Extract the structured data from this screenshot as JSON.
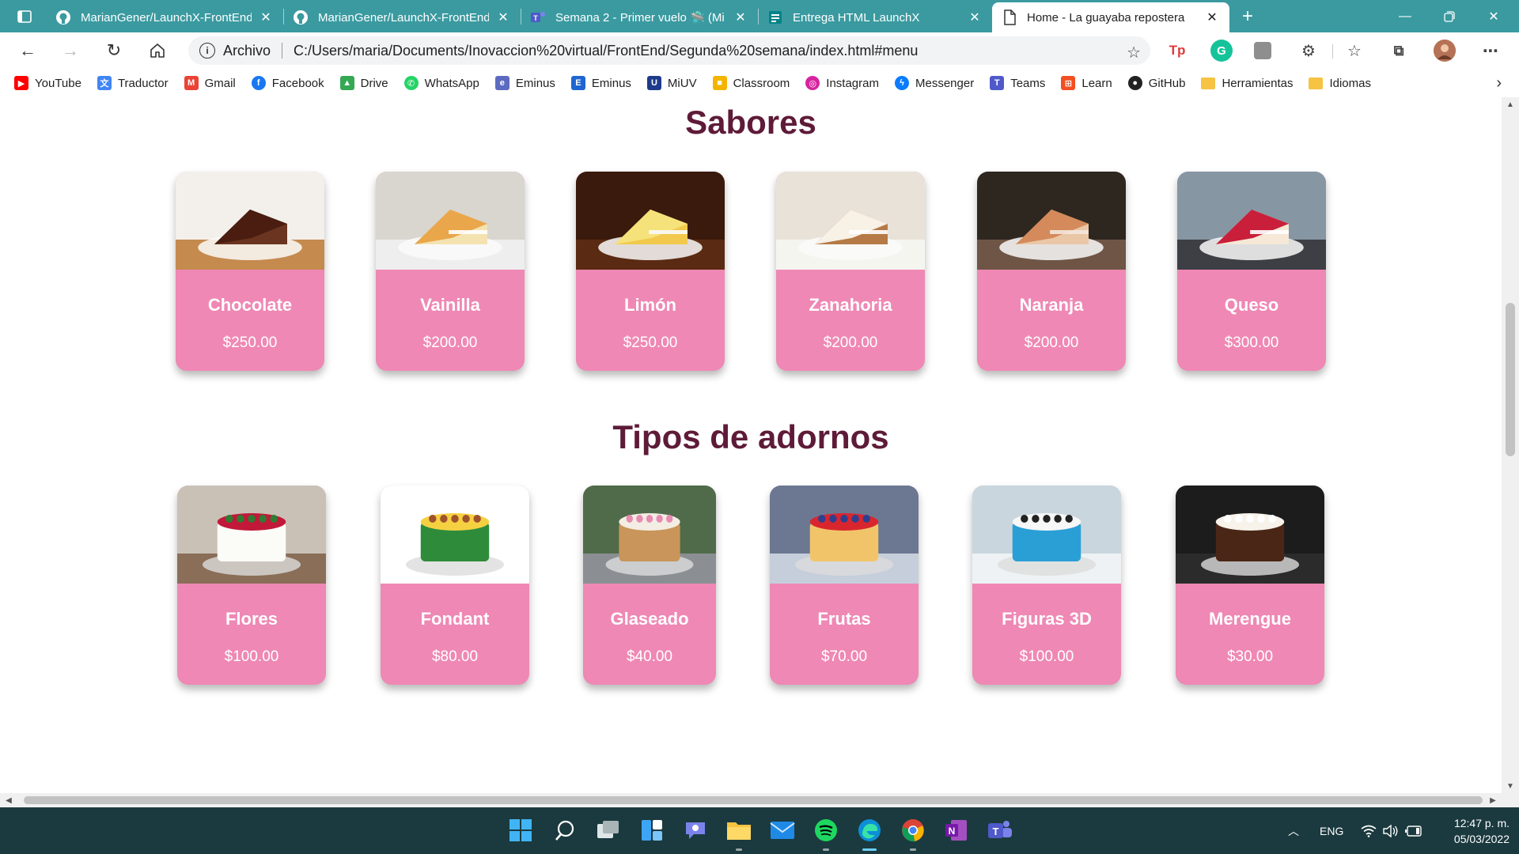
{
  "browser": {
    "tabs": [
      {
        "title": "MarianGener/LaunchX-FrontEnd",
        "icon": "github-icon",
        "active": false
      },
      {
        "title": "MarianGener/LaunchX-FrontEnd",
        "icon": "github-icon",
        "active": false
      },
      {
        "title": "Semana 2 - Primer vuelo 🛸 (Mi",
        "icon": "teams-icon",
        "active": false
      },
      {
        "title": "Entrega HTML LaunchX",
        "icon": "forms-icon",
        "active": false
      },
      {
        "title": "Home - La guayaba repostera",
        "icon": "page-icon",
        "active": true
      }
    ],
    "address": {
      "label": "Archivo",
      "url": "C:/Users/maria/Documents/Inovaccion%20virtual/FrontEnd/Segunda%20semana/index.html#menu"
    },
    "bookmarks": [
      {
        "label": "YouTube",
        "icon": "youtube-icon",
        "color": "#ff0000"
      },
      {
        "label": "Traductor",
        "icon": "translate-icon",
        "color": "#4285f4"
      },
      {
        "label": "Gmail",
        "icon": "gmail-icon",
        "color": "#ea4335"
      },
      {
        "label": "Facebook",
        "icon": "facebook-icon",
        "color": "#1877f2"
      },
      {
        "label": "Drive",
        "icon": "drive-icon",
        "color": "#34a853"
      },
      {
        "label": "WhatsApp",
        "icon": "whatsapp-icon",
        "color": "#25d366"
      },
      {
        "label": "Eminus",
        "icon": "eminus-icon",
        "color": "#5c6bc0"
      },
      {
        "label": "Eminus",
        "icon": "eminus-e-icon",
        "color": "#1e66d0"
      },
      {
        "label": "MiUV",
        "icon": "miuv-icon",
        "color": "#1e3a8a"
      },
      {
        "label": "Classroom",
        "icon": "classroom-icon",
        "color": "#f4b400"
      },
      {
        "label": "Instagram",
        "icon": "instagram-icon",
        "color": "#d6249f"
      },
      {
        "label": "Messenger",
        "icon": "messenger-icon",
        "color": "#0a7cff"
      },
      {
        "label": "Teams",
        "icon": "teams-icon",
        "color": "#5059c9"
      },
      {
        "label": "Learn",
        "icon": "microsoft-icon",
        "color": "#f25022"
      },
      {
        "label": "GitHub",
        "icon": "github-icon",
        "color": "#222222"
      },
      {
        "label": "Herramientas",
        "icon": "folder-icon",
        "color": "#f6c343"
      },
      {
        "label": "Idiomas",
        "icon": "folder-icon",
        "color": "#f6c343"
      }
    ]
  },
  "page": {
    "sections": [
      {
        "title": "Sabores",
        "items": [
          {
            "name": "Chocolate",
            "price": "$250.00"
          },
          {
            "name": "Vainilla",
            "price": "$200.00"
          },
          {
            "name": "Limón",
            "price": "$250.00"
          },
          {
            "name": "Zanahoria",
            "price": "$200.00"
          },
          {
            "name": "Naranja",
            "price": "$200.00"
          },
          {
            "name": "Queso",
            "price": "$300.00"
          }
        ]
      },
      {
        "title": "Tipos de adornos",
        "items": [
          {
            "name": "Flores",
            "price": "$100.00"
          },
          {
            "name": "Fondant",
            "price": "$80.00"
          },
          {
            "name": "Glaseado",
            "price": "$40.00"
          },
          {
            "name": "Frutas",
            "price": "$70.00"
          },
          {
            "name": "Figuras 3D",
            "price": "$100.00"
          },
          {
            "name": "Merengue",
            "price": "$30.00"
          }
        ]
      }
    ]
  },
  "taskbar": {
    "language": "ENG",
    "time": "12:47 p. m.",
    "date": "05/03/2022"
  },
  "colors": {
    "tab_strip": "#3a9aa0",
    "card": "#ef88b4",
    "heading": "#5e1b38",
    "taskbar": "#1b3a3f"
  }
}
